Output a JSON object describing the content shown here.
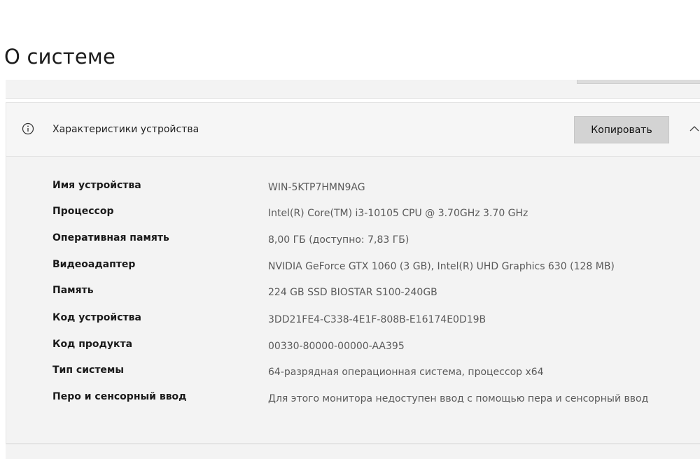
{
  "page": {
    "title": "О системе"
  },
  "device_specs": {
    "title": "Характеристики устройства",
    "copy_label": "Копировать",
    "rows": [
      {
        "label": "Имя устройства",
        "value": "WIN-5KTP7HMN9AG"
      },
      {
        "label": "Процессор",
        "value": "Intel(R) Core(TM) i3-10105 CPU @ 3.70GHz   3.70 GHz"
      },
      {
        "label": "Оперативная память",
        "value": "8,00 ГБ (доступно: 7,83 ГБ)"
      },
      {
        "label": "Видеоадаптер",
        "value": "NVIDIA GeForce GTX 1060 (3 GB), Intel(R) UHD Graphics 630 (128 MB)"
      },
      {
        "label": "Память",
        "value": "224 GB SSD BIOSTAR S100-240GB"
      },
      {
        "label": "Код устройства",
        "value": "3DD21FE4-C338-4E1F-808B-E16174E0D19B"
      },
      {
        "label": "Код продукта",
        "value": "00330-80000-00000-AA395"
      },
      {
        "label": "Тип системы",
        "value": "64-разрядная операционная система, процессор x64"
      },
      {
        "label": "Перо и сенсорный ввод",
        "value": "Для этого монитора недоступен ввод с помощью пера и сенсорный ввод"
      }
    ]
  },
  "icons": {
    "info": "info-icon",
    "collapse": "chevron-up-icon"
  },
  "colors": {
    "card_background": "#f3f3f3",
    "button_background": "#d3d3d3",
    "value_text": "#5a5a5a"
  }
}
